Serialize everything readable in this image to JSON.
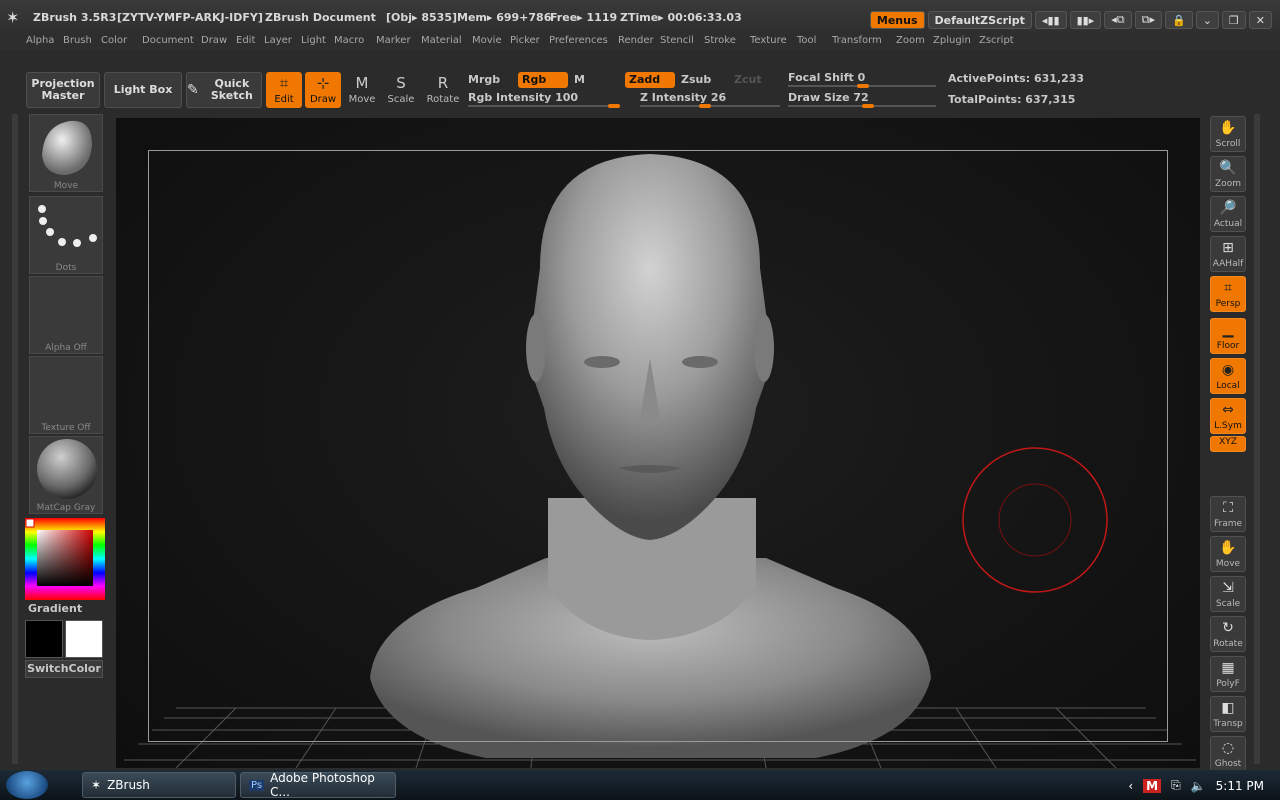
{
  "window": {
    "app_version": "ZBrush 3.5R3",
    "serial": "[ZYTV-YMFP-ARKJ-IDFY]",
    "doc_title": "ZBrush Document",
    "obj": "[Obj▸ 8535]",
    "mem": "Mem▸ 699+786",
    "free": "Free▸ 1119",
    "ztime": "ZTime▸ 00:06:33.03",
    "menus_button": "Menus",
    "zscript_button": "DefaultZScript"
  },
  "menubar": [
    "Alpha",
    "Brush",
    "Color",
    "Document",
    "Draw",
    "Edit",
    "Layer",
    "Light",
    "Macro",
    "Marker",
    "Material",
    "Movie",
    "Picker",
    "Preferences",
    "Render",
    "Stencil",
    "Stroke",
    "Texture",
    "Tool",
    "Transform",
    "Zoom",
    "Zplugin",
    "Zscript"
  ],
  "toolbar": {
    "projection_master": "Projection Master",
    "light_box": "Light Box",
    "quick_sketch": "Quick Sketch",
    "edit": "Edit",
    "draw": "Draw",
    "move": "Move",
    "scale": "Scale",
    "rotate": "Rotate",
    "mrgb": "Mrgb",
    "rgb": "Rgb",
    "m": "M",
    "zadd": "Zadd",
    "zsub": "Zsub",
    "zcut": "Zcut",
    "rgb_intensity": "Rgb Intensity 100",
    "z_intensity": "Z Intensity 26",
    "focal_shift": "Focal Shift 0",
    "draw_size": "Draw Size 72",
    "active_points": "ActivePoints: 631,233",
    "total_points": "TotalPoints: 637,315"
  },
  "left_panel": {
    "brush": "Move",
    "stroke": "Dots",
    "alpha": "Alpha Off",
    "texture": "Texture Off",
    "material": "MatCap Gray",
    "gradient": "Gradient",
    "switch_color": "SwitchColor"
  },
  "right_panel": [
    {
      "label": "Scroll",
      "icon": "hand-icon",
      "on": false
    },
    {
      "label": "Zoom",
      "icon": "zoom-icon",
      "on": false
    },
    {
      "label": "Actual",
      "icon": "actual-icon",
      "on": false
    },
    {
      "label": "AAHalf",
      "icon": "aahalf-icon",
      "on": false
    },
    {
      "label": "Persp",
      "icon": "perspective-icon",
      "on": true
    },
    {
      "label": "Floor",
      "icon": "floor-icon",
      "on": true
    },
    {
      "label": "Local",
      "icon": "local-icon",
      "on": true
    },
    {
      "label": "L.Sym",
      "icon": "symmetry-icon",
      "on": true
    },
    {
      "label": "XYZ",
      "icon": "xyz-icon",
      "on": true
    },
    {
      "label": "Frame",
      "icon": "frame-icon",
      "on": false
    },
    {
      "label": "Move",
      "icon": "move-icon",
      "on": false
    },
    {
      "label": "Scale",
      "icon": "scale-icon",
      "on": false
    },
    {
      "label": "Rotate",
      "icon": "rotate-icon",
      "on": false
    },
    {
      "label": "PolyF",
      "icon": "polyframe-icon",
      "on": false
    },
    {
      "label": "Transp",
      "icon": "transparency-icon",
      "on": false
    },
    {
      "label": "Ghost",
      "icon": "ghost-icon",
      "on": false
    }
  ],
  "taskbar": {
    "task1": "ZBrush",
    "task2": "Adobe Photoshop C...",
    "clock": "5:11 PM"
  },
  "colors": {
    "accent": "#f07800",
    "brush_cursor": "#c01818"
  }
}
